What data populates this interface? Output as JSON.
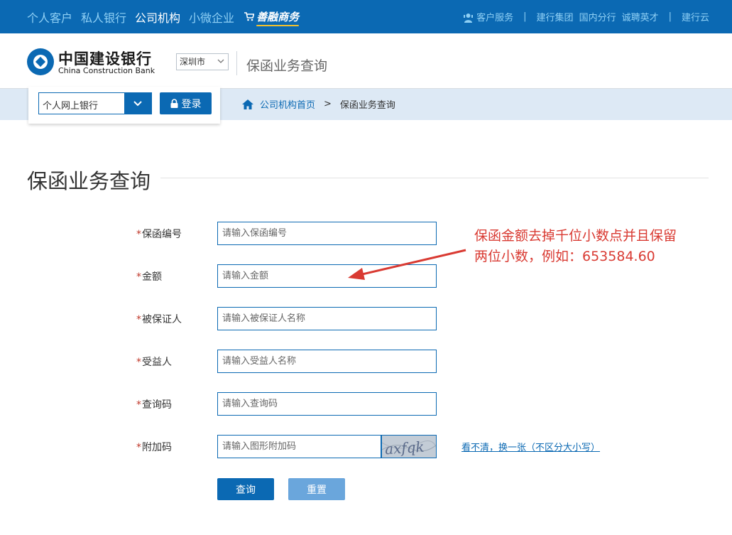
{
  "topnav": {
    "items": [
      {
        "label": "个人客户",
        "active": false
      },
      {
        "label": "私人银行",
        "active": false
      },
      {
        "label": "公司机构",
        "active": true
      },
      {
        "label": "小微企业",
        "active": false
      }
    ],
    "shop_label": "善融商务",
    "right_links": [
      "客户服务",
      "建行集团",
      "国内分行",
      "诚聘英才",
      "建行云"
    ]
  },
  "header": {
    "bank_name_cn": "中国建设银行",
    "bank_name_en": "China Construction Bank",
    "city": "深圳市",
    "title": "保函业务查询"
  },
  "login": {
    "bank_type": "个人网上银行",
    "login_label": "登录"
  },
  "breadcrumb": {
    "home": "公司机构首页",
    "separator": ">",
    "current": "保函业务查询"
  },
  "page": {
    "title": "保函业务查询"
  },
  "form": {
    "required_mark": "*",
    "fields": [
      {
        "label": "保函编号",
        "placeholder": "请输入保函编号",
        "value": ""
      },
      {
        "label": "金额",
        "placeholder": "请输入金额",
        "value": ""
      },
      {
        "label": "被保证人",
        "placeholder": "请输入被保证人名称",
        "value": ""
      },
      {
        "label": "受益人",
        "placeholder": "请输入受益人名称",
        "value": ""
      },
      {
        "label": "查询码",
        "placeholder": "请输入查询码",
        "value": ""
      },
      {
        "label": "附加码",
        "placeholder": "请输入图形附加码",
        "value": ""
      }
    ],
    "captcha_text": "axfqk",
    "refresh_text": "看不清，换一张（不区分大小写）",
    "query_label": "查询",
    "reset_label": "重置"
  },
  "annotation": {
    "line1": "保函金额去掉千位小数点并且保留",
    "line2": "两位小数，例如：653584.60"
  },
  "colors": {
    "brand_blue": "#0b69b3",
    "nav_link": "#8fd0f5",
    "strip_bg": "#dde9f5",
    "annotation_red": "#d93a32",
    "reset_button": "#6aa6dc"
  }
}
